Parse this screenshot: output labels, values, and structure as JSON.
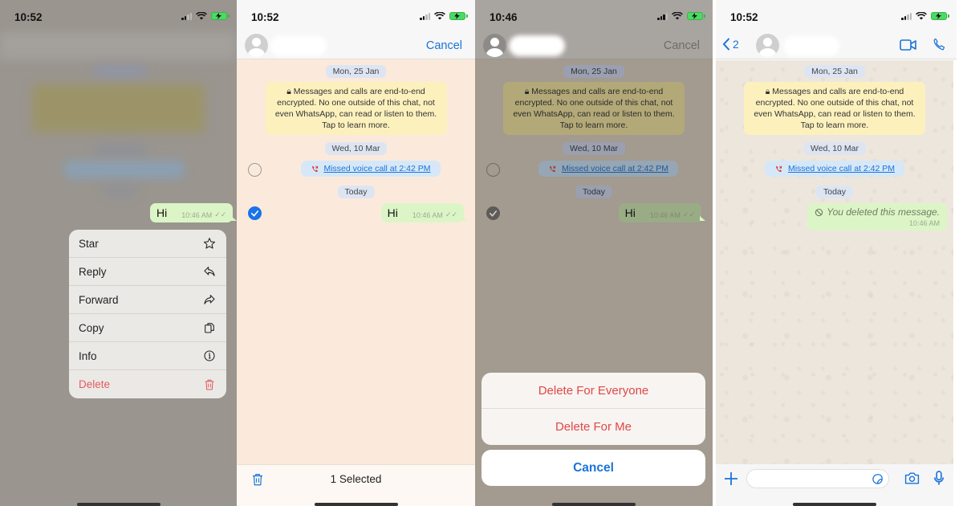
{
  "colors": {
    "accent_blue": "#1a73d9",
    "danger_red": "#e04848",
    "outgoing_bubble": "#dcf5c6",
    "encryption_notice_bg": "#fcf1bd",
    "date_chip_bg": "#dde5f3",
    "call_bubble_bg": "#d6e8f7"
  },
  "panels": [
    {
      "status_time": "10:52",
      "message": {
        "text": "Hi",
        "time": "10:46 AM"
      },
      "context_menu": [
        {
          "label": "Star",
          "icon": "star-icon"
        },
        {
          "label": "Reply",
          "icon": "reply-icon"
        },
        {
          "label": "Forward",
          "icon": "forward-icon"
        },
        {
          "label": "Copy",
          "icon": "copy-icon"
        },
        {
          "label": "Info",
          "icon": "info-icon"
        },
        {
          "label": "Delete",
          "icon": "trash-icon"
        }
      ]
    },
    {
      "status_time": "10:52",
      "cancel_label": "Cancel",
      "selected_count_label": "1 Selected"
    },
    {
      "status_time": "10:46",
      "cancel_label": "Cancel",
      "action_sheet": {
        "delete_for_everyone": "Delete For Everyone",
        "delete_for_me": "Delete For Me",
        "cancel": "Cancel"
      }
    },
    {
      "status_time": "10:52",
      "back_count": "2",
      "deleted_message": {
        "text": "You deleted this message.",
        "time": "10:46 AM"
      }
    }
  ],
  "chat": {
    "date_1": "Mon, 25 Jan",
    "encryption_notice": "Messages and calls are end-to-end encrypted. No one outside of this chat, not even WhatsApp, can read or listen to them. Tap to learn more.",
    "date_2": "Wed, 10 Mar",
    "missed_call": "Missed voice call at 2:42 PM",
    "date_3": "Today",
    "message_text": "Hi",
    "message_time": "10:46 AM"
  }
}
